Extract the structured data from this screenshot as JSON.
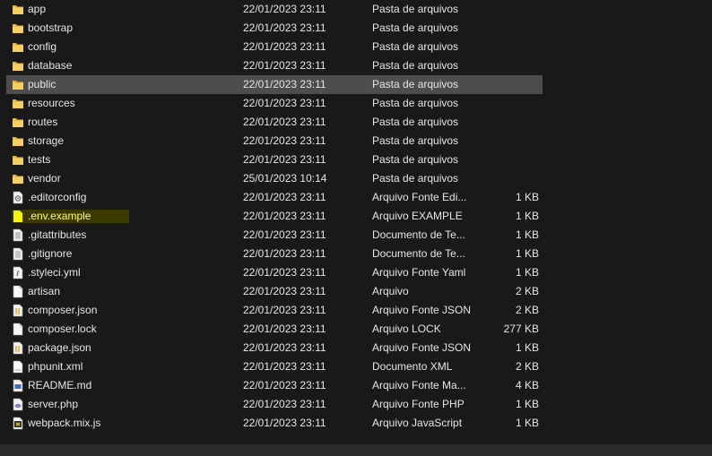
{
  "files": [
    {
      "name": "app",
      "date": "22/01/2023 23:11",
      "type": "Pasta de arquivos",
      "size": "",
      "icon": "folder-icon"
    },
    {
      "name": "bootstrap",
      "date": "22/01/2023 23:11",
      "type": "Pasta de arquivos",
      "size": "",
      "icon": "folder-icon"
    },
    {
      "name": "config",
      "date": "22/01/2023 23:11",
      "type": "Pasta de arquivos",
      "size": "",
      "icon": "folder-icon"
    },
    {
      "name": "database",
      "date": "22/01/2023 23:11",
      "type": "Pasta de arquivos",
      "size": "",
      "icon": "folder-icon"
    },
    {
      "name": "public",
      "date": "22/01/2023 23:11",
      "type": "Pasta de arquivos",
      "size": "",
      "icon": "folder-icon",
      "selected": true
    },
    {
      "name": "resources",
      "date": "22/01/2023 23:11",
      "type": "Pasta de arquivos",
      "size": "",
      "icon": "folder-icon"
    },
    {
      "name": "routes",
      "date": "22/01/2023 23:11",
      "type": "Pasta de arquivos",
      "size": "",
      "icon": "folder-icon"
    },
    {
      "name": "storage",
      "date": "22/01/2023 23:11",
      "type": "Pasta de arquivos",
      "size": "",
      "icon": "folder-icon"
    },
    {
      "name": "tests",
      "date": "22/01/2023 23:11",
      "type": "Pasta de arquivos",
      "size": "",
      "icon": "folder-icon"
    },
    {
      "name": "vendor",
      "date": "25/01/2023 10:14",
      "type": "Pasta de arquivos",
      "size": "",
      "icon": "folder-icon"
    },
    {
      "name": ".editorconfig",
      "date": "22/01/2023 23:11",
      "type": "Arquivo Fonte Edi...",
      "size": "1 KB",
      "icon": "config-file-icon"
    },
    {
      "name": ".env.example",
      "date": "22/01/2023 23:11",
      "type": "Arquivo EXAMPLE",
      "size": "1 KB",
      "icon": "highlighted-file-icon",
      "highlight": true
    },
    {
      "name": ".gitattributes",
      "date": "22/01/2023 23:11",
      "type": "Documento de Te...",
      "size": "1 KB",
      "icon": "text-document-icon"
    },
    {
      "name": ".gitignore",
      "date": "22/01/2023 23:11",
      "type": "Documento de Te...",
      "size": "1 KB",
      "icon": "text-document-icon"
    },
    {
      "name": ".styleci.yml",
      "date": "22/01/2023 23:11",
      "type": "Arquivo Fonte Yaml",
      "size": "1 KB",
      "icon": "yaml-file-icon"
    },
    {
      "name": "artisan",
      "date": "22/01/2023 23:11",
      "type": "Arquivo",
      "size": "2 KB",
      "icon": "blank-file-icon"
    },
    {
      "name": "composer.json",
      "date": "22/01/2023 23:11",
      "type": "Arquivo Fonte JSON",
      "size": "2 KB",
      "icon": "json-file-icon"
    },
    {
      "name": "composer.lock",
      "date": "22/01/2023 23:11",
      "type": "Arquivo LOCK",
      "size": "277 KB",
      "icon": "blank-file-icon"
    },
    {
      "name": "package.json",
      "date": "22/01/2023 23:11",
      "type": "Arquivo Fonte JSON",
      "size": "1 KB",
      "icon": "json-file-icon"
    },
    {
      "name": "phpunit.xml",
      "date": "22/01/2023 23:11",
      "type": "Documento XML",
      "size": "2 KB",
      "icon": "xml-file-icon"
    },
    {
      "name": "README.md",
      "date": "22/01/2023 23:11",
      "type": "Arquivo Fonte Ma...",
      "size": "4 KB",
      "icon": "markdown-file-icon"
    },
    {
      "name": "server.php",
      "date": "22/01/2023 23:11",
      "type": "Arquivo Fonte PHP",
      "size": "1 KB",
      "icon": "php-file-icon"
    },
    {
      "name": "webpack.mix.js",
      "date": "22/01/2023 23:11",
      "type": "Arquivo JavaScript",
      "size": "1 KB",
      "icon": "javascript-file-icon"
    }
  ],
  "colors": {
    "background": "#191919",
    "selected_row": "#4d4d4d",
    "folder": "#f3c34f",
    "highlight_text": "#ffff66"
  }
}
